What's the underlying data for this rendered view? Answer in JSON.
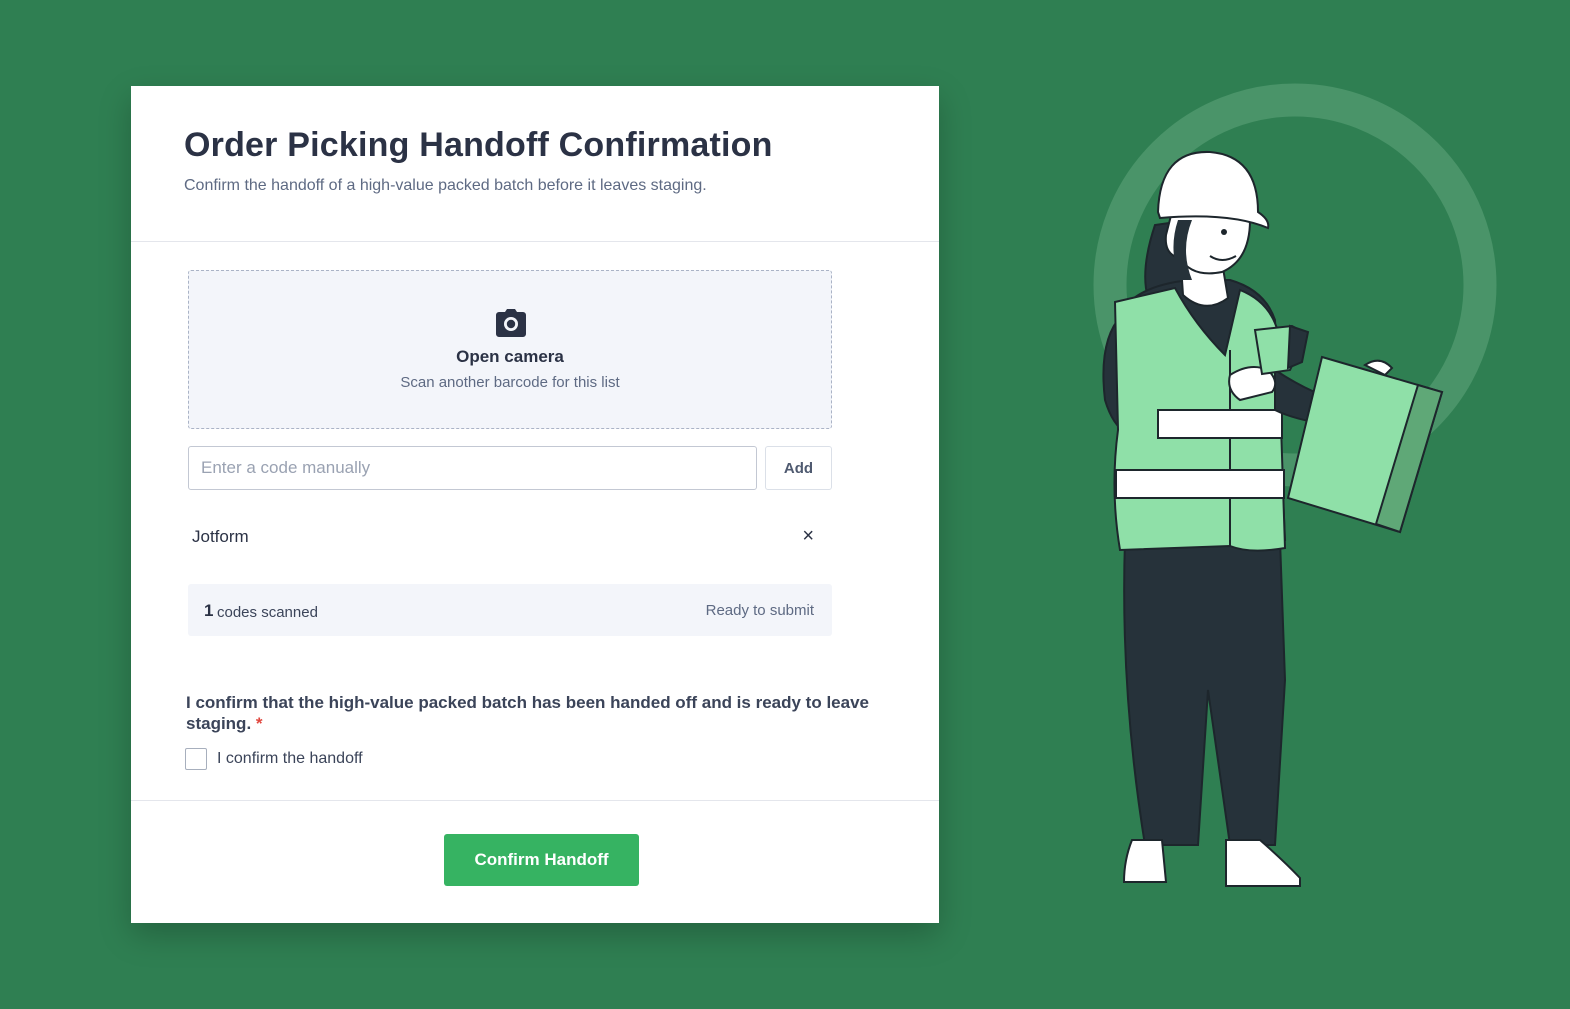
{
  "form": {
    "title": "Order Picking Handoff Confirmation",
    "subtitle": "Confirm the handoff of a high-value packed batch before it leaves staging."
  },
  "scanner": {
    "icon": "camera-icon",
    "label": "Open camera",
    "sublabel": "Scan another barcode for this list"
  },
  "manual_entry": {
    "placeholder": "Enter a code manually",
    "value": "",
    "add_label": "Add"
  },
  "scanned_items": [
    {
      "value": "Jotform",
      "remove_icon": "close-icon",
      "remove_glyph": "×"
    }
  ],
  "summary": {
    "count": "1",
    "count_label": "codes scanned",
    "status": "Ready to submit"
  },
  "confirmation": {
    "question": "I confirm that the high-value packed batch has been handed off and is ready to leave staging.",
    "required_mark": "*",
    "checkbox_label": "I confirm the handoff",
    "checked": false
  },
  "submit": {
    "label": "Confirm Handoff"
  },
  "colors": {
    "background": "#2f7f52",
    "submit": "#36b362",
    "required": "#e0463d",
    "vest": "#8fe0a8"
  }
}
